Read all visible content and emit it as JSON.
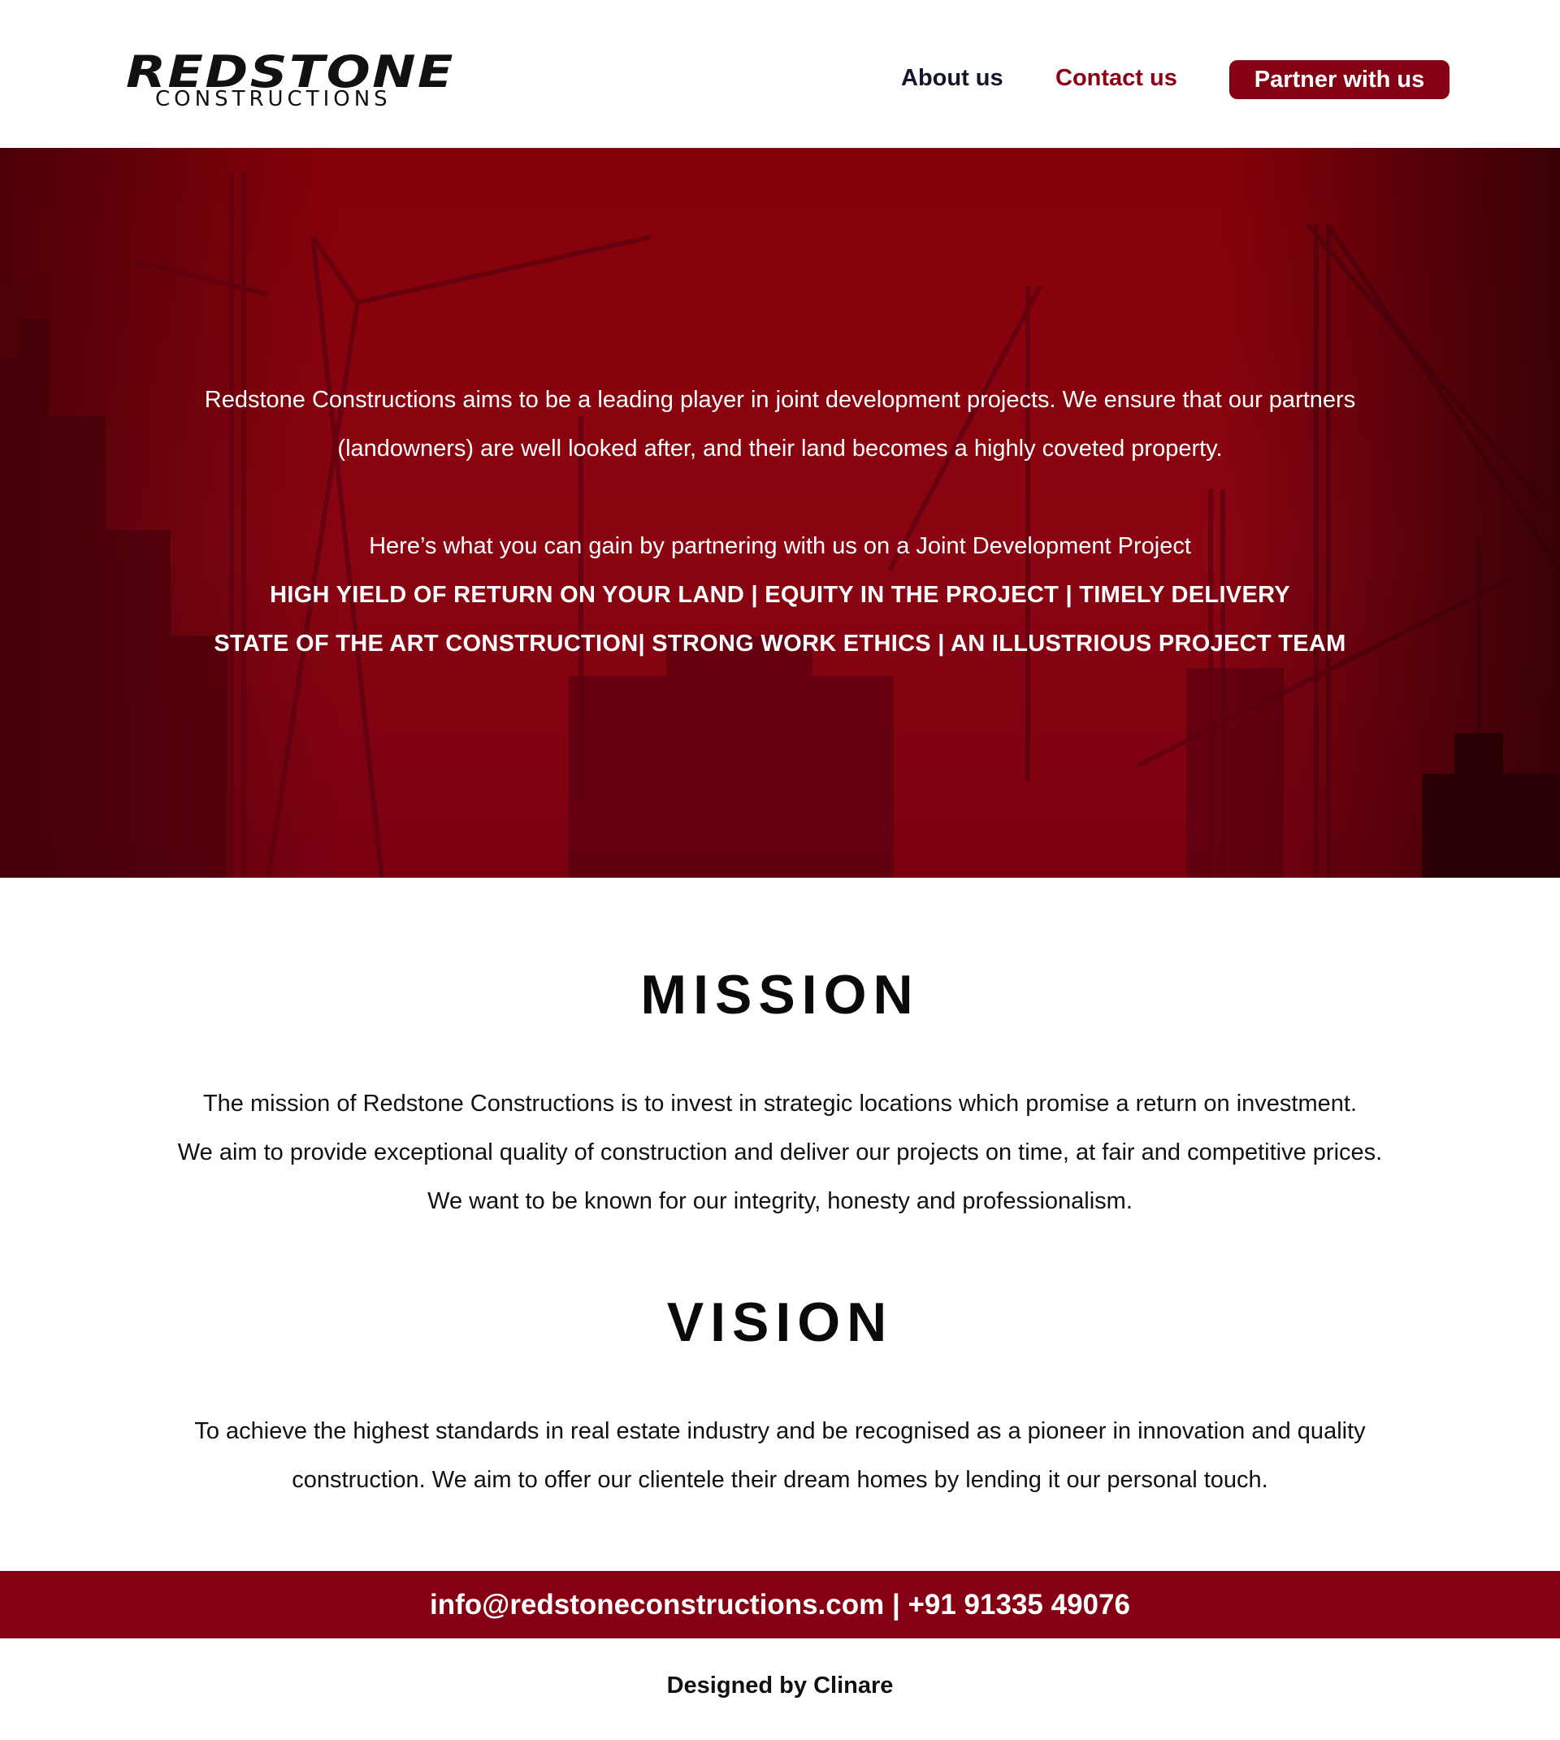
{
  "header": {
    "logo_main": "REDSTONE",
    "logo_sub": "CONSTRUCTIONS",
    "nav": {
      "about": "About us",
      "contact": "Contact us",
      "partner": "Partner with us"
    }
  },
  "hero": {
    "intro_line1": "Redstone Constructions aims to be a leading player in joint development projects. We ensure that our partners",
    "intro_line2": "(landowners) are well looked after, and their land becomes a highly coveted property.",
    "gain_line": "Here’s what you can gain by partnering with us on a Joint Development Project",
    "benefits_line1": "HIGH YIELD OF RETURN ON YOUR LAND | EQUITY IN THE PROJECT | TIMELY DELIVERY",
    "benefits_line2": "STATE OF THE ART CONSTRUCTION| STRONG WORK ETHICS | AN ILLUSTRIOUS PROJECT TEAM"
  },
  "mission": {
    "title": "MISSION",
    "line1": "The mission of Redstone Constructions is to invest in strategic locations which promise a return on investment.",
    "line2": "We aim to provide exceptional quality of construction and deliver our projects on time, at fair and competitive prices.",
    "line3": "We want to be known for our integrity, honesty and professionalism."
  },
  "vision": {
    "title": "VISION",
    "line1": "To achieve the highest standards in real estate industry and be recognised as a pioneer in innovation and quality",
    "line2": "construction. We aim to offer our clientele their dream homes by lending it our personal touch."
  },
  "footer": {
    "contact": "info@redstoneconstructions.com | +91 91335 49076",
    "credit": "Designed by Clinare"
  },
  "colors": {
    "brand_red": "#860014",
    "nav_dark": "#12172b",
    "text": "#111111"
  }
}
